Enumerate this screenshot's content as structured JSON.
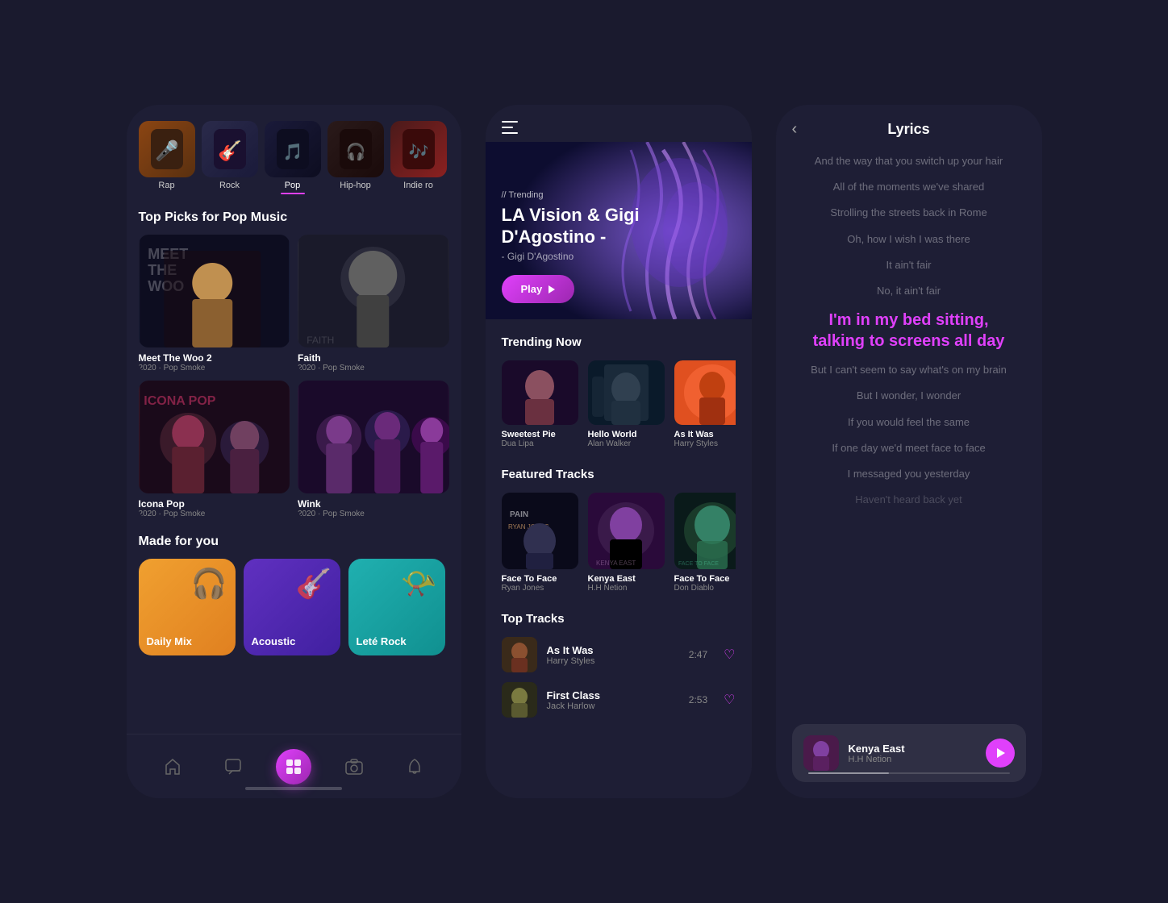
{
  "leftPhone": {
    "genres": [
      {
        "id": "rap",
        "label": "Rap",
        "active": false,
        "emoji": "🎤"
      },
      {
        "id": "rock",
        "label": "Rock",
        "active": false,
        "emoji": "🎸"
      },
      {
        "id": "pop",
        "label": "Pop",
        "active": true,
        "emoji": "🎵"
      },
      {
        "id": "hiphop",
        "label": "Hip-hop",
        "active": false,
        "emoji": "🎧"
      },
      {
        "id": "indie",
        "label": "Indie ro",
        "active": false,
        "emoji": "🎶"
      }
    ],
    "topPicksTitle": "Top Picks for Pop Music",
    "albums": [
      {
        "id": "meet-woo",
        "title": "Meet The Woo 2",
        "year": "2020",
        "artist": "Pop Smoke"
      },
      {
        "id": "faith",
        "title": "Faith",
        "year": "2020",
        "artist": "Pop Smoke"
      },
      {
        "id": "icona-pop",
        "title": "Icona Pop",
        "year": "2020",
        "artist": "Pop Smoke"
      },
      {
        "id": "wink",
        "title": "Wink",
        "year": "2020",
        "artist": "Pop Smoke"
      }
    ],
    "madeForYouTitle": "Made for you",
    "mfyCards": [
      {
        "id": "daily",
        "label": "Daily Mix",
        "icon": "🎧"
      },
      {
        "id": "acoustic",
        "label": "Acoustic",
        "icon": "🎸"
      },
      {
        "id": "lete",
        "label": "Leté Rock",
        "icon": "🎺"
      }
    ],
    "navItems": [
      {
        "id": "home",
        "icon": "⌂",
        "active": false
      },
      {
        "id": "chat",
        "icon": "💬",
        "active": false
      },
      {
        "id": "library",
        "icon": "⊞",
        "active": true
      },
      {
        "id": "camera",
        "icon": "📷",
        "active": false
      },
      {
        "id": "bell",
        "icon": "🔔",
        "active": false
      }
    ]
  },
  "middlePhone": {
    "trending": {
      "label": "// Trending",
      "title": "LA Vision & Gigi D'Agostino -",
      "artist": "- Gigi D'Agostino",
      "playLabel": "Play"
    },
    "trendingNowTitle": "Trending Now",
    "trendingNow": [
      {
        "id": "sweetest-pie",
        "name": "Sweetest Pie",
        "artist": "Dua Lipa",
        "emoji": "👩"
      },
      {
        "id": "hello-world",
        "name": "Hello World",
        "artist": "Alan Walker",
        "emoji": "🥷"
      },
      {
        "id": "as-it-was",
        "name": "As It Was",
        "artist": "Harry Styles",
        "emoji": "👤"
      }
    ],
    "featuredTitle": "Featured Tracks",
    "featured": [
      {
        "id": "face-to-face1",
        "name": "Face To Face",
        "artist": "Ryan Jones",
        "emoji": "🎭"
      },
      {
        "id": "kenya-east",
        "name": "Kenya East",
        "artist": "H.H Netion",
        "emoji": "🎵"
      },
      {
        "id": "face-to-face2",
        "name": "Face To Face",
        "artist": "Don Diablo",
        "emoji": "👽"
      }
    ],
    "topTracksTitle": "Top Tracks",
    "topTracks": [
      {
        "id": "as-it-was",
        "name": "As It Was",
        "artist": "Harry Styles",
        "duration": "2:47",
        "emoji": "🎵"
      },
      {
        "id": "first-class",
        "name": "First Class",
        "artist": "Jack Harlow",
        "duration": "2:53",
        "emoji": "🎵"
      }
    ]
  },
  "rightPhone": {
    "title": "Lyrics",
    "lines": [
      {
        "id": 1,
        "text": "And the way that you switch up your hair",
        "active": false
      },
      {
        "id": 2,
        "text": "All of the moments we've shared",
        "active": false
      },
      {
        "id": 3,
        "text": "Strolling the streets back in Rome",
        "active": false
      },
      {
        "id": 4,
        "text": "Oh, how I wish I was there",
        "active": false
      },
      {
        "id": 5,
        "text": "It ain't fair",
        "active": false
      },
      {
        "id": 6,
        "text": "No, it ain't fair",
        "active": false
      },
      {
        "id": 7,
        "text": "I'm in my bed sitting,\ntalking to screens all day",
        "active": true
      },
      {
        "id": 8,
        "text": "But I can't seem to say what's on my brain",
        "active": false
      },
      {
        "id": 9,
        "text": "But I wonder, I wonder",
        "active": false
      },
      {
        "id": 10,
        "text": "If you would feel the same",
        "active": false
      },
      {
        "id": 11,
        "text": "If one day we'd meet face to face",
        "active": false
      },
      {
        "id": 12,
        "text": "I messaged you yesterday",
        "active": false
      },
      {
        "id": 13,
        "text": "Haven't heard back yet",
        "active": false
      }
    ],
    "nowPlaying": {
      "name": "Kenya East",
      "artist": "H.H Netion",
      "emoji": "🎵"
    }
  }
}
